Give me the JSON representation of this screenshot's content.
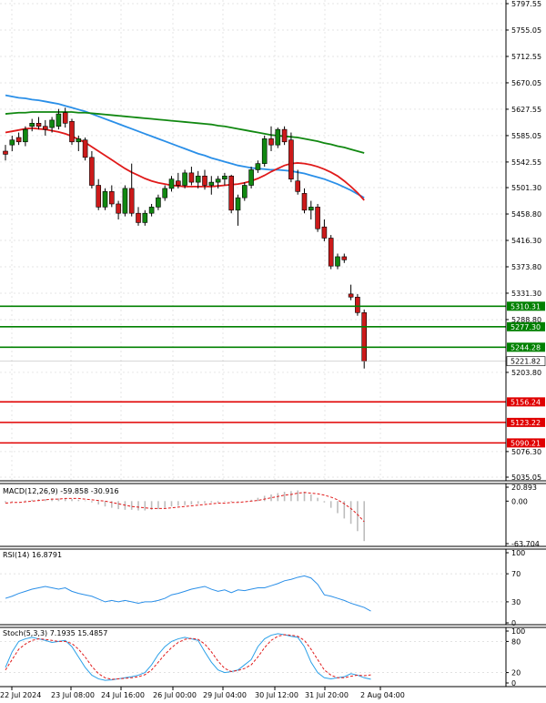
{
  "chart_data": {
    "type": "candlestick",
    "instrument_panel": {
      "y_axis_ticks": [
        5797.55,
        5755.05,
        5712.55,
        5670.05,
        5627.55,
        5585.05,
        5542.55,
        5501.3,
        5458.8,
        5416.3,
        5373.8,
        5331.3,
        5288.8,
        5203.8,
        5076.3,
        5035.05
      ],
      "ylim": [
        5035.05,
        5797.55
      ],
      "levels": [
        {
          "value": 5310.31,
          "label": "5310.31",
          "color": "#008000"
        },
        {
          "value": 5277.3,
          "label": "5277.30",
          "color": "#008000"
        },
        {
          "value": 5244.28,
          "label": "5244.28",
          "color": "#008000"
        },
        {
          "value": 5156.24,
          "label": "5156.24",
          "color": "#e00000"
        },
        {
          "value": 5123.22,
          "label": "5123.22",
          "color": "#e00000"
        },
        {
          "value": 5090.21,
          "label": "5090.21",
          "color": "#e00000"
        }
      ],
      "current_price": {
        "value": 5221.82,
        "label": "5221.82"
      },
      "candles": [
        [
          5560,
          5570,
          5545,
          5555
        ],
        [
          5570,
          5585,
          5560,
          5578
        ],
        [
          5582,
          5590,
          5570,
          5575
        ],
        [
          5575,
          5600,
          5568,
          5595
        ],
        [
          5600,
          5612,
          5592,
          5605
        ],
        [
          5605,
          5615,
          5595,
          5600
        ],
        [
          5600,
          5610,
          5585,
          5595
        ],
        [
          5598,
          5615,
          5590,
          5610
        ],
        [
          5600,
          5628,
          5595,
          5620
        ],
        [
          5622,
          5630,
          5598,
          5605
        ],
        [
          5608,
          5612,
          5570,
          5575
        ],
        [
          5575,
          5585,
          5560,
          5580
        ],
        [
          5578,
          5582,
          5545,
          5550
        ],
        [
          5550,
          5560,
          5500,
          5505
        ],
        [
          5505,
          5515,
          5465,
          5470
        ],
        [
          5470,
          5500,
          5465,
          5495
        ],
        [
          5495,
          5505,
          5470,
          5475
        ],
        [
          5475,
          5480,
          5450,
          5460
        ],
        [
          5460,
          5505,
          5455,
          5500
        ],
        [
          5500,
          5540,
          5455,
          5460
        ],
        [
          5460,
          5470,
          5440,
          5445
        ],
        [
          5445,
          5465,
          5440,
          5460
        ],
        [
          5460,
          5475,
          5455,
          5470
        ],
        [
          5470,
          5490,
          5465,
          5485
        ],
        [
          5485,
          5505,
          5480,
          5500
        ],
        [
          5500,
          5520,
          5495,
          5515
        ],
        [
          5512,
          5525,
          5500,
          5505
        ],
        [
          5505,
          5530,
          5500,
          5525
        ],
        [
          5525,
          5535,
          5505,
          5510
        ],
        [
          5510,
          5528,
          5500,
          5520
        ],
        [
          5520,
          5530,
          5498,
          5505
        ],
        [
          5505,
          5520,
          5490,
          5510
        ],
        [
          5510,
          5520,
          5500,
          5515
        ],
        [
          5515,
          5525,
          5505,
          5520
        ],
        [
          5520,
          5522,
          5460,
          5465
        ],
        [
          5465,
          5490,
          5440,
          5485
        ],
        [
          5485,
          5510,
          5480,
          5505
        ],
        [
          5505,
          5535,
          5500,
          5530
        ],
        [
          5530,
          5545,
          5525,
          5540
        ],
        [
          5540,
          5585,
          5535,
          5580
        ],
        [
          5580,
          5600,
          5560,
          5570
        ],
        [
          5570,
          5598,
          5565,
          5595
        ],
        [
          5595,
          5600,
          5570,
          5575
        ],
        [
          5578,
          5590,
          5510,
          5515
        ],
        [
          5512,
          5530,
          5490,
          5495
        ],
        [
          5492,
          5500,
          5460,
          5465
        ],
        [
          5465,
          5480,
          5450,
          5470
        ],
        [
          5470,
          5475,
          5430,
          5435
        ],
        [
          5438,
          5450,
          5415,
          5420
        ],
        [
          5420,
          5425,
          5370,
          5375
        ],
        [
          5375,
          5395,
          5370,
          5390
        ],
        [
          5390,
          5395,
          5380,
          5385
        ],
        [
          5330,
          5345,
          5320,
          5325
        ],
        [
          5325,
          5330,
          5295,
          5300
        ],
        [
          5300,
          5305,
          5210,
          5221.82
        ]
      ],
      "moving_averages": [
        {
          "color": "#2a8fe8",
          "values": [
            5650,
            5648,
            5646,
            5645,
            5643,
            5642,
            5640,
            5638,
            5636,
            5633,
            5630,
            5627,
            5624,
            5620,
            5616,
            5612,
            5608,
            5604,
            5600,
            5596,
            5592,
            5588,
            5584,
            5580,
            5576,
            5572,
            5568,
            5564,
            5560,
            5556,
            5553,
            5549,
            5546,
            5543,
            5540,
            5537,
            5535,
            5533,
            5532,
            5531,
            5530,
            5530,
            5529,
            5528,
            5526,
            5524,
            5521,
            5518,
            5515,
            5511,
            5507,
            5502,
            5497,
            5491,
            5485
          ]
        },
        {
          "color": "#118811",
          "values": [
            5620,
            5621,
            5622,
            5622,
            5623,
            5623,
            5623,
            5623,
            5623,
            5623,
            5623,
            5622,
            5622,
            5621,
            5620,
            5619,
            5618,
            5617,
            5616,
            5615,
            5614,
            5613,
            5612,
            5611,
            5610,
            5609,
            5608,
            5607,
            5606,
            5605,
            5604,
            5603,
            5601,
            5600,
            5598,
            5596,
            5594,
            5592,
            5590,
            5588,
            5586,
            5585,
            5584,
            5583,
            5582,
            5580,
            5578,
            5576,
            5573,
            5571,
            5568,
            5566,
            5563,
            5560,
            5557
          ]
        },
        {
          "color": "#e01a1a",
          "values": [
            5590,
            5592,
            5594,
            5596,
            5597,
            5596,
            5595,
            5593,
            5591,
            5588,
            5584,
            5579,
            5574,
            5567,
            5560,
            5553,
            5546,
            5539,
            5532,
            5526,
            5521,
            5516,
            5512,
            5509,
            5507,
            5505,
            5504,
            5503,
            5503,
            5503,
            5503,
            5503,
            5504,
            5505,
            5506,
            5507,
            5509,
            5512,
            5516,
            5521,
            5527,
            5532,
            5537,
            5540,
            5541,
            5540,
            5538,
            5535,
            5531,
            5526,
            5520,
            5512,
            5503,
            5493,
            5481
          ]
        }
      ]
    },
    "macd": {
      "label": "MACD(12,26,9) -59.858 -30.916",
      "y_axis_ticks": [
        20.893,
        0.0,
        -63.704
      ],
      "tick_labels": [
        "20.893",
        "0.00",
        "-63.704"
      ],
      "ylim": [
        -63.704,
        20.893
      ],
      "histogram": [
        -2,
        -1,
        0,
        1,
        2,
        3,
        3,
        4,
        4,
        4,
        3,
        2,
        1,
        -2,
        -5,
        -8,
        -10,
        -12,
        -13,
        -13,
        -14,
        -14,
        -13,
        -12,
        -10,
        -8,
        -7,
        -6,
        -5,
        -4,
        -3,
        -2,
        -2,
        -1,
        -1,
        -1,
        0,
        2,
        5,
        8,
        10,
        12,
        14,
        15,
        16,
        14,
        10,
        5,
        -2,
        -10,
        -18,
        -26,
        -34,
        -45,
        -59.858
      ],
      "signal": [
        -3,
        -2,
        -2,
        -1,
        0,
        1,
        2,
        3,
        3,
        4,
        4,
        4,
        3,
        2,
        1,
        0,
        -2,
        -4,
        -6,
        -8,
        -9,
        -10,
        -11,
        -11,
        -11,
        -10,
        -9,
        -8,
        -7,
        -6,
        -5,
        -4,
        -3,
        -3,
        -2,
        -2,
        -1,
        0,
        1,
        3,
        5,
        7,
        9,
        10,
        12,
        13,
        12,
        11,
        9,
        6,
        2,
        -4,
        -11,
        -20,
        -30.916
      ]
    },
    "rsi": {
      "label": "RSI(14) 16.8791",
      "y_axis_ticks": [
        100,
        70,
        30,
        0
      ],
      "tick_labels": [
        "100",
        "70",
        "30",
        "0"
      ],
      "ylim": [
        0,
        100
      ],
      "values": [
        35,
        38,
        42,
        45,
        48,
        50,
        52,
        50,
        48,
        50,
        45,
        42,
        40,
        38,
        34,
        30,
        32,
        30,
        32,
        30,
        28,
        30,
        30,
        32,
        35,
        40,
        42,
        45,
        48,
        50,
        52,
        48,
        45,
        47,
        43,
        47,
        46,
        48,
        50,
        50,
        53,
        56,
        60,
        62,
        65,
        67,
        64,
        55,
        40,
        38,
        35,
        32,
        28,
        25,
        22,
        16.8791
      ]
    },
    "stoch": {
      "label": "Stoch(5,3,3) 7.1935 15.4857",
      "y_axis_ticks": [
        100,
        80,
        20,
        0
      ],
      "tick_labels": [
        "100",
        "80",
        "20",
        "0"
      ],
      "ylim": [
        0,
        100
      ],
      "k": [
        30,
        60,
        80,
        85,
        88,
        85,
        82,
        78,
        80,
        82,
        70,
        50,
        30,
        15,
        8,
        5,
        6,
        8,
        10,
        12,
        15,
        20,
        35,
        55,
        70,
        80,
        85,
        88,
        85,
        82,
        60,
        40,
        25,
        20,
        22,
        25,
        35,
        45,
        70,
        85,
        92,
        95,
        93,
        90,
        88,
        70,
        40,
        20,
        10,
        8,
        10,
        12,
        18,
        15,
        10,
        7.1935
      ],
      "d": [
        25,
        45,
        65,
        75,
        82,
        85,
        84,
        82,
        80,
        80,
        76,
        65,
        50,
        32,
        18,
        10,
        7,
        8,
        9,
        10,
        12,
        16,
        25,
        40,
        55,
        68,
        78,
        84,
        86,
        84,
        75,
        60,
        42,
        28,
        22,
        24,
        28,
        35,
        50,
        68,
        82,
        90,
        93,
        92,
        90,
        82,
        65,
        45,
        25,
        15,
        10,
        10,
        13,
        15,
        14,
        15.4857
      ]
    },
    "x_tick_labels": [
      "22 Jul 2024",
      "23 Jul 08:00",
      "24 Jul 16:00",
      "26 Jul 00:00",
      "29 Jul 04:00",
      "30 Jul 12:00",
      "31 Jul 20:00",
      "2 Aug 04:00"
    ],
    "colors": {
      "bull": "#118811",
      "bear": "#cc1a1a",
      "wick": "#000000",
      "panel_border": "#000000",
      "macd_histogram": "#bdbdbd",
      "macd_signal": "#e01a1a",
      "rsi_line": "#2a8fe8",
      "stoch_k": "#2aa0e8",
      "stoch_d": "#e01a1a"
    }
  }
}
